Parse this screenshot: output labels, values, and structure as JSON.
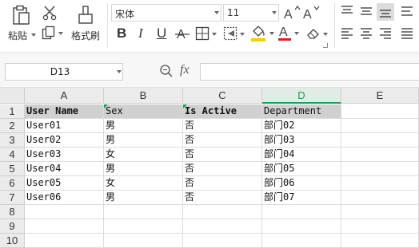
{
  "ribbon": {
    "paste_label": "粘贴",
    "format_painter_label": "格式刷",
    "font_name": "宋体",
    "font_size": "11",
    "bold_glyph": "B",
    "italic_glyph": "I",
    "underline_glyph": "U",
    "font_color": "#e02020",
    "fill_color": "#f5d000"
  },
  "formula_bar": {
    "name_box": "D13",
    "fx": "fx",
    "formula": ""
  },
  "grid": {
    "columns": [
      "A",
      "B",
      "C",
      "D",
      "E"
    ],
    "active_column": "D",
    "rows": [
      "1",
      "2",
      "3",
      "4",
      "5",
      "6",
      "7",
      "8",
      "9",
      "10"
    ],
    "header_row": [
      "User Name",
      "Sex",
      "Is Active",
      "Department"
    ],
    "data": [
      [
        "User01",
        "男",
        "否",
        "部门02"
      ],
      [
        "User02",
        "男",
        "否",
        "部门03"
      ],
      [
        "User03",
        "女",
        "否",
        "部门04"
      ],
      [
        "User04",
        "男",
        "否",
        "部门05"
      ],
      [
        "User05",
        "女",
        "否",
        "部门06"
      ],
      [
        "User06",
        "男",
        "否",
        "部门07"
      ]
    ],
    "accent_color": "#1e9b54"
  }
}
